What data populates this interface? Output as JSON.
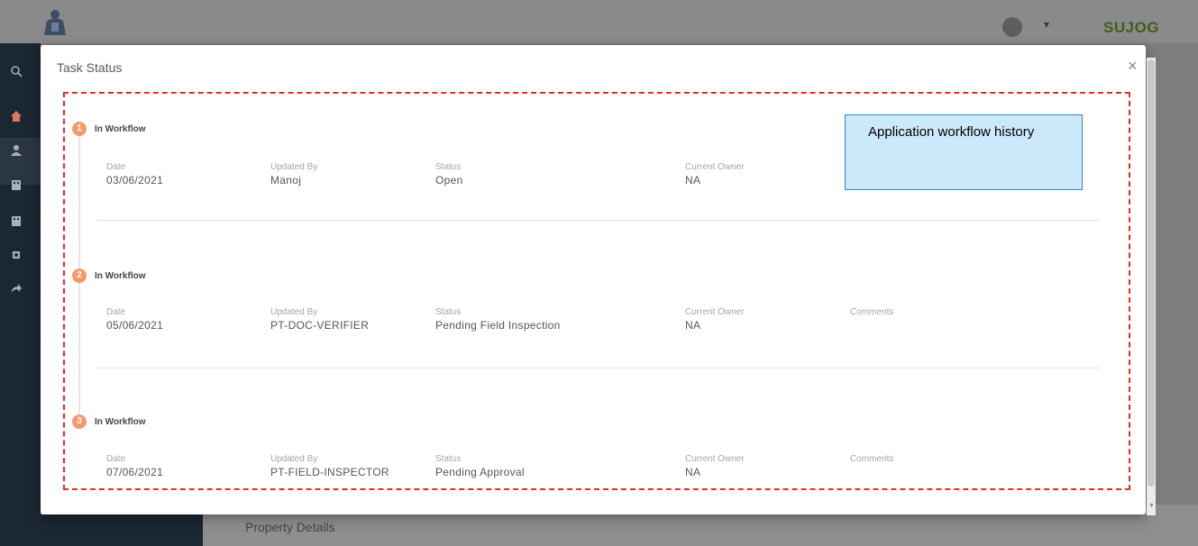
{
  "header": {
    "brand": "SUJOG",
    "caret": "▾"
  },
  "background": {
    "section_title": "Property Details"
  },
  "modal": {
    "title": "Task Status",
    "close_symbol": "×"
  },
  "labels": {
    "date": "Date",
    "updated_by": "Updated By",
    "status": "Status",
    "current_owner": "Current Owner",
    "comments": "Comments"
  },
  "steps": [
    {
      "number": "1",
      "name": "In Workflow",
      "date": "03/06/2021",
      "updated_by": "Manoj",
      "status": "Open",
      "current_owner": "NA"
    },
    {
      "number": "2",
      "name": "In Workflow",
      "date": "05/06/2021",
      "updated_by": "PT-DOC-VERIFIER",
      "status": "Pending Field Inspection",
      "current_owner": "NA"
    },
    {
      "number": "3",
      "name": "In Workflow",
      "date": "07/06/2021",
      "updated_by": "PT-FIELD-INSPECTOR",
      "status": "Pending Approval",
      "current_owner": "NA"
    }
  ],
  "annotation": {
    "text": "Application workflow history",
    "fill_color": "#cce9fb",
    "border_color": "#3f7fc2",
    "highlight_color": "#e62a2a"
  },
  "icons": [
    "search-icon",
    "home-icon",
    "user-icon",
    "building-icon",
    "building-icon",
    "gear-icon",
    "share-icon",
    "avatar-icon",
    "close-icon"
  ]
}
